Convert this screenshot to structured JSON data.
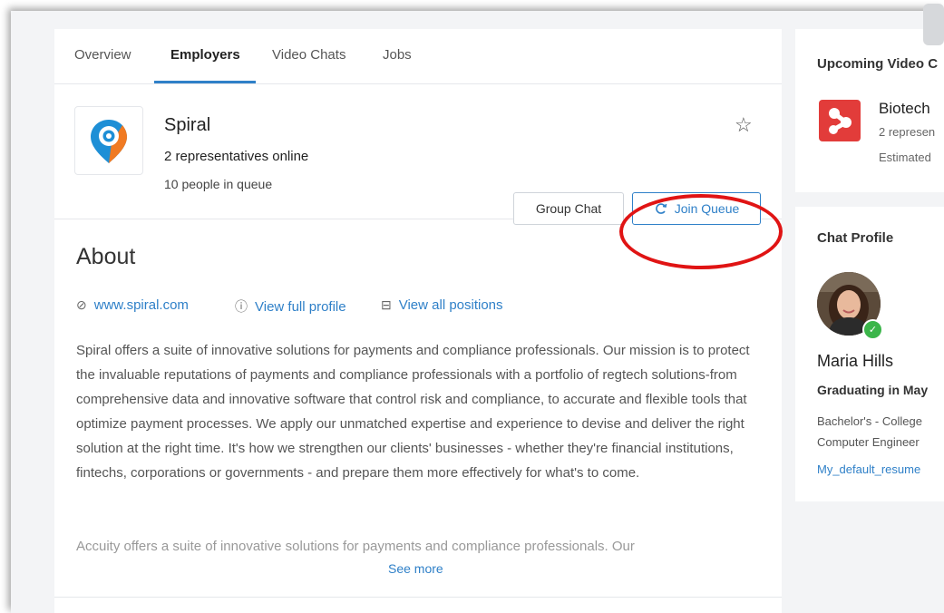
{
  "tabs": [
    {
      "label": "Overview"
    },
    {
      "label": "Employers"
    },
    {
      "label": "Video Chats"
    },
    {
      "label": "Jobs"
    }
  ],
  "employer": {
    "name": "Spiral",
    "representatives": "2 representatives online",
    "queue": "10 people in queue",
    "group_chat_label": "Group Chat",
    "join_queue_label": "Join Queue"
  },
  "about": {
    "title": "About",
    "website": "www.spiral.com",
    "full_profile": "View full profile",
    "all_positions": "View all positions",
    "description": "Spiral offers a suite of innovative solutions for payments and compliance professionals. Our mission is to protect the invaluable reputations of payments and compliance professionals with a portfolio of regtech solutions-from comprehensive data and innovative software that control risk and compliance, to accurate and flexible tools that optimize payment processes. We apply our unmatched expertise and experience to devise and deliver the right solution at the right time. It's how we strengthen our clients' businesses - whether they're financial institutions, fintechs, corporations or governments - and prepare them more effectively for what's to come.",
    "description_preview": "Accuity offers a suite of innovative solutions for payments and compliance professionals. Our",
    "see_more": "See more"
  },
  "upcoming": {
    "title": "Upcoming Video C",
    "company": "Biotech",
    "reps": "2 represen",
    "estimated": "Estimated"
  },
  "chat_profile": {
    "title": "Chat Profile",
    "name": "Maria Hills",
    "graduating": "Graduating in May",
    "degree": "Bachelor's - College",
    "major": "Computer Engineer",
    "resume": "My_default_resume"
  },
  "colors": {
    "accent": "#2f80c8",
    "highlight": "#e01414",
    "logo_red": "#e23c3a"
  },
  "icons": [
    "star-icon",
    "link-icon",
    "info-icon",
    "briefcase-icon",
    "refresh-icon",
    "check-icon"
  ]
}
